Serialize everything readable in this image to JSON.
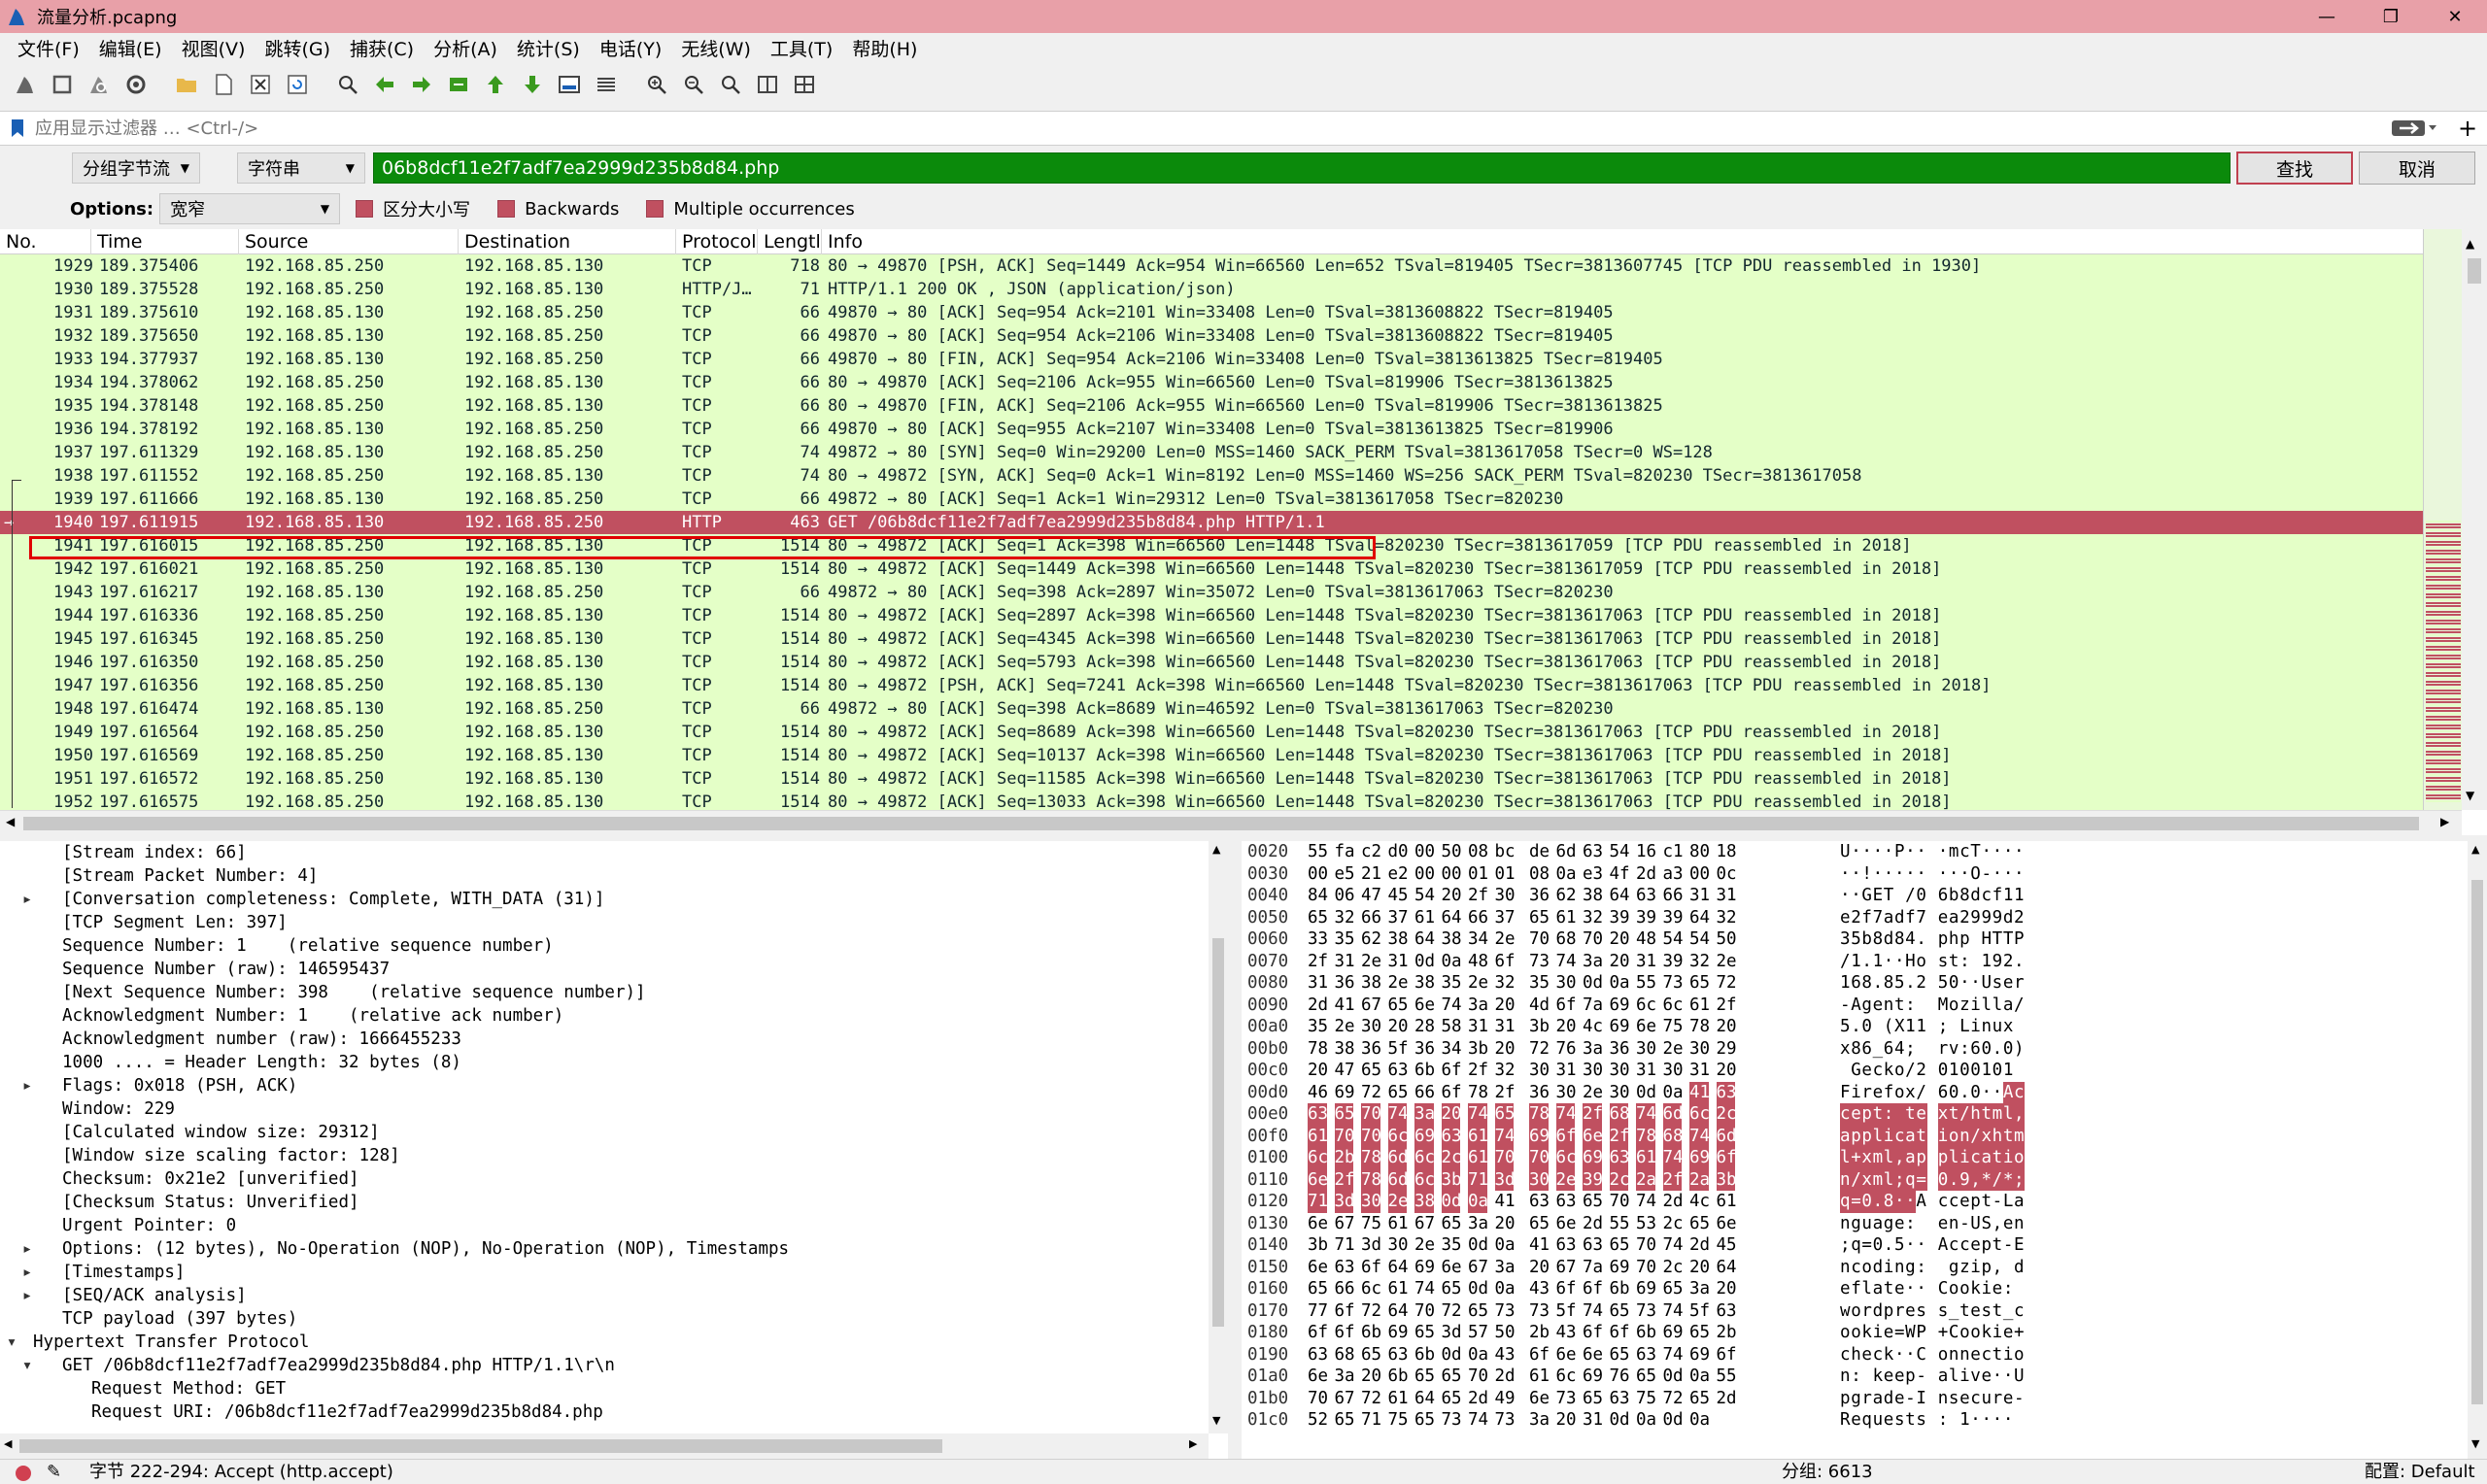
{
  "window": {
    "title": "流量分析.pcapng",
    "minimize": "—",
    "maximize": "❐",
    "close": "✕"
  },
  "menu": [
    "文件(F)",
    "编辑(E)",
    "视图(V)",
    "跳转(G)",
    "捕获(C)",
    "分析(A)",
    "统计(S)",
    "电话(Y)",
    "无线(W)",
    "工具(T)",
    "帮助(H)"
  ],
  "filter": {
    "placeholder": "应用显示过滤器 … <Ctrl-/>"
  },
  "find": {
    "scope": "分组字节流",
    "type": "字符串",
    "value": "06b8dcf11e2f7adf7ea2999d235b8d84.php",
    "find_label": "查找",
    "cancel_label": "取消",
    "options_label": "Options:",
    "charset": "宽窄",
    "case_label": "区分大小写",
    "backwards_label": "Backwards",
    "multiple_label": "Multiple occurrences"
  },
  "columns": [
    "No.",
    "Time",
    "Source",
    "Destination",
    "Protocol",
    "Lengtl",
    "Info"
  ],
  "packets": [
    {
      "no": "1929",
      "time": "189.375406",
      "src": "192.168.85.250",
      "dst": "192.168.85.130",
      "proto": "TCP",
      "len": "718",
      "info": "80 → 49870 [PSH, ACK] Seq=1449 Ack=954 Win=66560 Len=652 TSval=819405 TSecr=3813607745 [TCP PDU reassembled in 1930]"
    },
    {
      "no": "1930",
      "time": "189.375528",
      "src": "192.168.85.250",
      "dst": "192.168.85.130",
      "proto": "HTTP/J…",
      "len": "71",
      "info": "HTTP/1.1 200 OK , JSON (application/json)"
    },
    {
      "no": "1931",
      "time": "189.375610",
      "src": "192.168.85.130",
      "dst": "192.168.85.250",
      "proto": "TCP",
      "len": "66",
      "info": "49870 → 80 [ACK] Seq=954 Ack=2101 Win=33408 Len=0 TSval=3813608822 TSecr=819405"
    },
    {
      "no": "1932",
      "time": "189.375650",
      "src": "192.168.85.130",
      "dst": "192.168.85.250",
      "proto": "TCP",
      "len": "66",
      "info": "49870 → 80 [ACK] Seq=954 Ack=2106 Win=33408 Len=0 TSval=3813608822 TSecr=819405"
    },
    {
      "no": "1933",
      "time": "194.377937",
      "src": "192.168.85.130",
      "dst": "192.168.85.250",
      "proto": "TCP",
      "len": "66",
      "info": "49870 → 80 [FIN, ACK] Seq=954 Ack=2106 Win=33408 Len=0 TSval=3813613825 TSecr=819405"
    },
    {
      "no": "1934",
      "time": "194.378062",
      "src": "192.168.85.250",
      "dst": "192.168.85.130",
      "proto": "TCP",
      "len": "66",
      "info": "80 → 49870 [ACK] Seq=2106 Ack=955 Win=66560 Len=0 TSval=819906 TSecr=3813613825"
    },
    {
      "no": "1935",
      "time": "194.378148",
      "src": "192.168.85.250",
      "dst": "192.168.85.130",
      "proto": "TCP",
      "len": "66",
      "info": "80 → 49870 [FIN, ACK] Seq=2106 Ack=955 Win=66560 Len=0 TSval=819906 TSecr=3813613825"
    },
    {
      "no": "1936",
      "time": "194.378192",
      "src": "192.168.85.130",
      "dst": "192.168.85.250",
      "proto": "TCP",
      "len": "66",
      "info": "49870 → 80 [ACK] Seq=955 Ack=2107 Win=33408 Len=0 TSval=3813613825 TSecr=819906"
    },
    {
      "no": "1937",
      "time": "197.611329",
      "src": "192.168.85.130",
      "dst": "192.168.85.250",
      "proto": "TCP",
      "len": "74",
      "info": "49872 → 80 [SYN] Seq=0 Win=29200 Len=0 MSS=1460 SACK_PERM TSval=3813617058 TSecr=0 WS=128"
    },
    {
      "no": "1938",
      "time": "197.611552",
      "src": "192.168.85.250",
      "dst": "192.168.85.130",
      "proto": "TCP",
      "len": "74",
      "info": "80 → 49872 [SYN, ACK] Seq=0 Ack=1 Win=8192 Len=0 MSS=1460 WS=256 SACK_PERM TSval=820230 TSecr=3813617058"
    },
    {
      "no": "1939",
      "time": "197.611666",
      "src": "192.168.85.130",
      "dst": "192.168.85.250",
      "proto": "TCP",
      "len": "66",
      "info": "49872 → 80 [ACK] Seq=1 Ack=1 Win=29312 Len=0 TSval=3813617058 TSecr=820230"
    },
    {
      "no": "1940",
      "time": "197.611915",
      "src": "192.168.85.130",
      "dst": "192.168.85.250",
      "proto": "HTTP",
      "len": "463",
      "info": "GET /06b8dcf11e2f7adf7ea2999d235b8d84.php HTTP/1.1 ",
      "selected": true
    },
    {
      "no": "1941",
      "time": "197.616015",
      "src": "192.168.85.250",
      "dst": "192.168.85.130",
      "proto": "TCP",
      "len": "1514",
      "info": "80 → 49872 [ACK] Seq=1 Ack=398 Win=66560 Len=1448 TSval=820230 TSecr=3813617059 [TCP PDU reassembled in 2018]"
    },
    {
      "no": "1942",
      "time": "197.616021",
      "src": "192.168.85.250",
      "dst": "192.168.85.130",
      "proto": "TCP",
      "len": "1514",
      "info": "80 → 49872 [ACK] Seq=1449 Ack=398 Win=66560 Len=1448 TSval=820230 TSecr=3813617059 [TCP PDU reassembled in 2018]"
    },
    {
      "no": "1943",
      "time": "197.616217",
      "src": "192.168.85.130",
      "dst": "192.168.85.250",
      "proto": "TCP",
      "len": "66",
      "info": "49872 → 80 [ACK] Seq=398 Ack=2897 Win=35072 Len=0 TSval=3813617063 TSecr=820230"
    },
    {
      "no": "1944",
      "time": "197.616336",
      "src": "192.168.85.250",
      "dst": "192.168.85.130",
      "proto": "TCP",
      "len": "1514",
      "info": "80 → 49872 [ACK] Seq=2897 Ack=398 Win=66560 Len=1448 TSval=820230 TSecr=3813617063 [TCP PDU reassembled in 2018]"
    },
    {
      "no": "1945",
      "time": "197.616345",
      "src": "192.168.85.250",
      "dst": "192.168.85.130",
      "proto": "TCP",
      "len": "1514",
      "info": "80 → 49872 [ACK] Seq=4345 Ack=398 Win=66560 Len=1448 TSval=820230 TSecr=3813617063 [TCP PDU reassembled in 2018]"
    },
    {
      "no": "1946",
      "time": "197.616350",
      "src": "192.168.85.250",
      "dst": "192.168.85.130",
      "proto": "TCP",
      "len": "1514",
      "info": "80 → 49872 [ACK] Seq=5793 Ack=398 Win=66560 Len=1448 TSval=820230 TSecr=3813617063 [TCP PDU reassembled in 2018]"
    },
    {
      "no": "1947",
      "time": "197.616356",
      "src": "192.168.85.250",
      "dst": "192.168.85.130",
      "proto": "TCP",
      "len": "1514",
      "info": "80 → 49872 [PSH, ACK] Seq=7241 Ack=398 Win=66560 Len=1448 TSval=820230 TSecr=3813617063 [TCP PDU reassembled in 2018]"
    },
    {
      "no": "1948",
      "time": "197.616474",
      "src": "192.168.85.130",
      "dst": "192.168.85.250",
      "proto": "TCP",
      "len": "66",
      "info": "49872 → 80 [ACK] Seq=398 Ack=8689 Win=46592 Len=0 TSval=3813617063 TSecr=820230"
    },
    {
      "no": "1949",
      "time": "197.616564",
      "src": "192.168.85.250",
      "dst": "192.168.85.130",
      "proto": "TCP",
      "len": "1514",
      "info": "80 → 49872 [ACK] Seq=8689 Ack=398 Win=66560 Len=1448 TSval=820230 TSecr=3813617063 [TCP PDU reassembled in 2018]"
    },
    {
      "no": "1950",
      "time": "197.616569",
      "src": "192.168.85.250",
      "dst": "192.168.85.130",
      "proto": "TCP",
      "len": "1514",
      "info": "80 → 49872 [ACK] Seq=10137 Ack=398 Win=66560 Len=1448 TSval=820230 TSecr=3813617063 [TCP PDU reassembled in 2018]"
    },
    {
      "no": "1951",
      "time": "197.616572",
      "src": "192.168.85.250",
      "dst": "192.168.85.130",
      "proto": "TCP",
      "len": "1514",
      "info": "80 → 49872 [ACK] Seq=11585 Ack=398 Win=66560 Len=1448 TSval=820230 TSecr=3813617063 [TCP PDU reassembled in 2018]"
    },
    {
      "no": "1952",
      "time": "197.616575",
      "src": "192.168.85.250",
      "dst": "192.168.85.130",
      "proto": "TCP",
      "len": "1514",
      "info": "80 → 49872 [ACK] Seq=13033 Ack=398 Win=66560 Len=1448 TSval=820230 TSecr=3813617063 [TCP PDU reassembled in 2018]"
    }
  ],
  "details": [
    {
      "indent": 2,
      "text": "[Stream index: 66]"
    },
    {
      "indent": 2,
      "text": "[Stream Packet Number: 4]"
    },
    {
      "indent": 2,
      "arrow": "›",
      "text": "[Conversation completeness: Complete, WITH_DATA (31)]"
    },
    {
      "indent": 2,
      "text": "[TCP Segment Len: 397]"
    },
    {
      "indent": 2,
      "text": "Sequence Number: 1    (relative sequence number)"
    },
    {
      "indent": 2,
      "text": "Sequence Number (raw): 146595437"
    },
    {
      "indent": 2,
      "text": "[Next Sequence Number: 398    (relative sequence number)]"
    },
    {
      "indent": 2,
      "text": "Acknowledgment Number: 1    (relative ack number)"
    },
    {
      "indent": 2,
      "text": "Acknowledgment number (raw): 1666455233"
    },
    {
      "indent": 2,
      "text": "1000 .... = Header Length: 32 bytes (8)"
    },
    {
      "indent": 2,
      "arrow": "›",
      "text": "Flags: 0x018 (PSH, ACK)"
    },
    {
      "indent": 2,
      "text": "Window: 229"
    },
    {
      "indent": 2,
      "text": "[Calculated window size: 29312]"
    },
    {
      "indent": 2,
      "text": "[Window size scaling factor: 128]"
    },
    {
      "indent": 2,
      "text": "Checksum: 0x21e2 [unverified]"
    },
    {
      "indent": 2,
      "text": "[Checksum Status: Unverified]"
    },
    {
      "indent": 2,
      "text": "Urgent Pointer: 0"
    },
    {
      "indent": 2,
      "arrow": "›",
      "text": "Options: (12 bytes), No-Operation (NOP), No-Operation (NOP), Timestamps"
    },
    {
      "indent": 2,
      "arrow": "›",
      "text": "[Timestamps]"
    },
    {
      "indent": 2,
      "arrow": "›",
      "text": "[SEQ/ACK analysis]"
    },
    {
      "indent": 2,
      "text": "TCP payload (397 bytes)"
    },
    {
      "indent": 1,
      "arrow": "⌄",
      "text": "Hypertext Transfer Protocol"
    },
    {
      "indent": 2,
      "arrow": "⌄",
      "text": "GET /06b8dcf11e2f7adf7ea2999d235b8d84.php HTTP/1.1\\r\\n"
    },
    {
      "indent": 3,
      "text": "Request Method: GET"
    },
    {
      "indent": 3,
      "text": "Request URI: /06b8dcf11e2f7adf7ea2999d235b8d84.php"
    }
  ],
  "bytes": [
    {
      "off": "0020",
      "hex": "55 fa c2 d0 00 50 08 bc de 6d 63 54 16 c1 80 18",
      "asc": "U····P·· ·mcT····",
      "hi": []
    },
    {
      "off": "0030",
      "hex": "00 e5 21 e2 00 00 01 01 08 0a e3 4f 2d a3 00 0c",
      "asc": "··!····· ···O-···",
      "hi": []
    },
    {
      "off": "0040",
      "hex": "84 06 47 45 54 20 2f 30 36 62 38 64 63 66 31 31",
      "asc": "··GET /0 6b8dcf11",
      "hi": []
    },
    {
      "off": "0050",
      "hex": "65 32 66 37 61 64 66 37 65 61 32 39 39 39 64 32",
      "asc": "e2f7adf7 ea2999d2",
      "hi": []
    },
    {
      "off": "0060",
      "hex": "33 35 62 38 64 38 34 2e 70 68 70 20 48 54 54 50",
      "asc": "35b8d84. php HTTP",
      "hi": []
    },
    {
      "off": "0070",
      "hex": "2f 31 2e 31 0d 0a 48 6f 73 74 3a 20 31 39 32 2e",
      "asc": "/1.1··Ho st: 192.",
      "hi": []
    },
    {
      "off": "0080",
      "hex": "31 36 38 2e 38 35 2e 32 35 30 0d 0a 55 73 65 72",
      "asc": "168.85.2 50··User",
      "hi": []
    },
    {
      "off": "0090",
      "hex": "2d 41 67 65 6e 74 3a 20 4d 6f 7a 69 6c 6c 61 2f",
      "asc": "-Agent:  Mozilla/",
      "hi": []
    },
    {
      "off": "00a0",
      "hex": "35 2e 30 20 28 58 31 31 3b 20 4c 69 6e 75 78 20",
      "asc": "5.0 (X11 ; Linux ",
      "hi": []
    },
    {
      "off": "00b0",
      "hex": "78 38 36 5f 36 34 3b 20 72 76 3a 36 30 2e 30 29",
      "asc": "x86_64;  rv:60.0)",
      "hi": []
    },
    {
      "off": "00c0",
      "hex": "20 47 65 63 6b 6f 2f 32 30 31 30 30 31 30 31 20",
      "asc": " Gecko/2 0100101 ",
      "hi": []
    },
    {
      "off": "00d0",
      "hex": "46 69 72 65 66 6f 78 2f 36 30 2e 30 0d 0a 41 63",
      "asc": "Firefox/ 60.0··Ac",
      "hi": [
        14,
        15
      ]
    },
    {
      "off": "00e0",
      "hex": "63 65 70 74 3a 20 74 65 78 74 2f 68 74 6d 6c 2c",
      "asc": "cept: te xt/html,",
      "hi": "all"
    },
    {
      "off": "00f0",
      "hex": "61 70 70 6c 69 63 61 74 69 6f 6e 2f 78 68 74 6d",
      "asc": "applicat ion/xhtm",
      "hi": "all"
    },
    {
      "off": "0100",
      "hex": "6c 2b 78 6d 6c 2c 61 70 70 6c 69 63 61 74 69 6f",
      "asc": "l+xml,ap plicatio",
      "hi": "all"
    },
    {
      "off": "0110",
      "hex": "6e 2f 78 6d 6c 3b 71 3d 30 2e 39 2c 2a 2f 2a 3b",
      "asc": "n/xml;q= 0.9,*/*;",
      "hi": "all"
    },
    {
      "off": "0120",
      "hex": "71 3d 30 2e 38 0d 0a 41 63 63 65 70 74 2d 4c 61",
      "asc": "q=0.8··A ccept-La",
      "hi": [
        0,
        1,
        2,
        3,
        4,
        5,
        6
      ]
    },
    {
      "off": "0130",
      "hex": "6e 67 75 61 67 65 3a 20 65 6e 2d 55 53 2c 65 6e",
      "asc": "nguage:  en-US,en",
      "hi": []
    },
    {
      "off": "0140",
      "hex": "3b 71 3d 30 2e 35 0d 0a 41 63 63 65 70 74 2d 45",
      "asc": ";q=0.5·· Accept-E",
      "hi": []
    },
    {
      "off": "0150",
      "hex": "6e 63 6f 64 69 6e 67 3a 20 67 7a 69 70 2c 20 64",
      "asc": "ncoding:  gzip, d",
      "hi": []
    },
    {
      "off": "0160",
      "hex": "65 66 6c 61 74 65 0d 0a 43 6f 6f 6b 69 65 3a 20",
      "asc": "eflate·· Cookie: ",
      "hi": []
    },
    {
      "off": "0170",
      "hex": "77 6f 72 64 70 72 65 73 73 5f 74 65 73 74 5f 63",
      "asc": "wordpres s_test_c",
      "hi": []
    },
    {
      "off": "0180",
      "hex": "6f 6f 6b 69 65 3d 57 50 2b 43 6f 6f 6b 69 65 2b",
      "asc": "ookie=WP +Cookie+",
      "hi": []
    },
    {
      "off": "0190",
      "hex": "63 68 65 63 6b 0d 0a 43 6f 6e 6e 65 63 74 69 6f",
      "asc": "check··C onnectio",
      "hi": []
    },
    {
      "off": "01a0",
      "hex": "6e 3a 20 6b 65 65 70 2d 61 6c 69 76 65 0d 0a 55",
      "asc": "n: keep- alive··U",
      "hi": []
    },
    {
      "off": "01b0",
      "hex": "70 67 72 61 64 65 2d 49 6e 73 65 63 75 72 65 2d",
      "asc": "pgrade-I nsecure-",
      "hi": []
    },
    {
      "off": "01c0",
      "hex": "52 65 71 75 65 73 74 73 3a 20 31 0d 0a 0d 0a",
      "asc": "Requests : 1····",
      "hi": []
    }
  ],
  "status": {
    "field": "字节 222-294: Accept (http.accept)",
    "packets": "分组: 6613",
    "profile": "配置: Default"
  },
  "colors": {
    "title_bg": "#e8a0a8",
    "row_tcp": "#e4ffc7",
    "selected": "#c05060",
    "find_bg": "#0b8a0b"
  }
}
